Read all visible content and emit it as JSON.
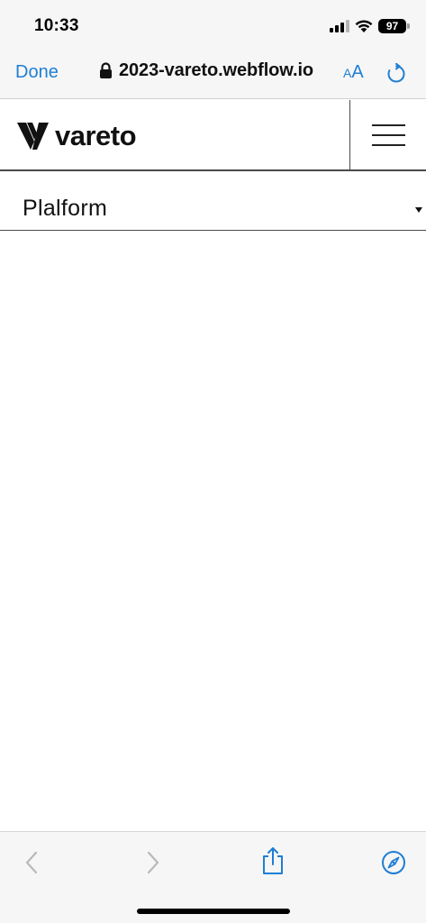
{
  "status_bar": {
    "time": "10:33",
    "battery_level": "97"
  },
  "browser": {
    "done_label": "Done",
    "url": "2023-vareto.webflow.io",
    "text_size_small": "A",
    "text_size_large": "A",
    "accent_color": "#1f7ed4"
  },
  "site": {
    "brand": "vareto",
    "dropdown_label": "Plalform"
  },
  "icons": {
    "lock": "lock-icon",
    "reload": "reload-icon",
    "menu": "hamburger-icon",
    "caret": "caret-down-icon",
    "back": "chevron-left-icon",
    "forward": "chevron-right-icon",
    "share": "share-icon",
    "compass": "compass-icon"
  }
}
